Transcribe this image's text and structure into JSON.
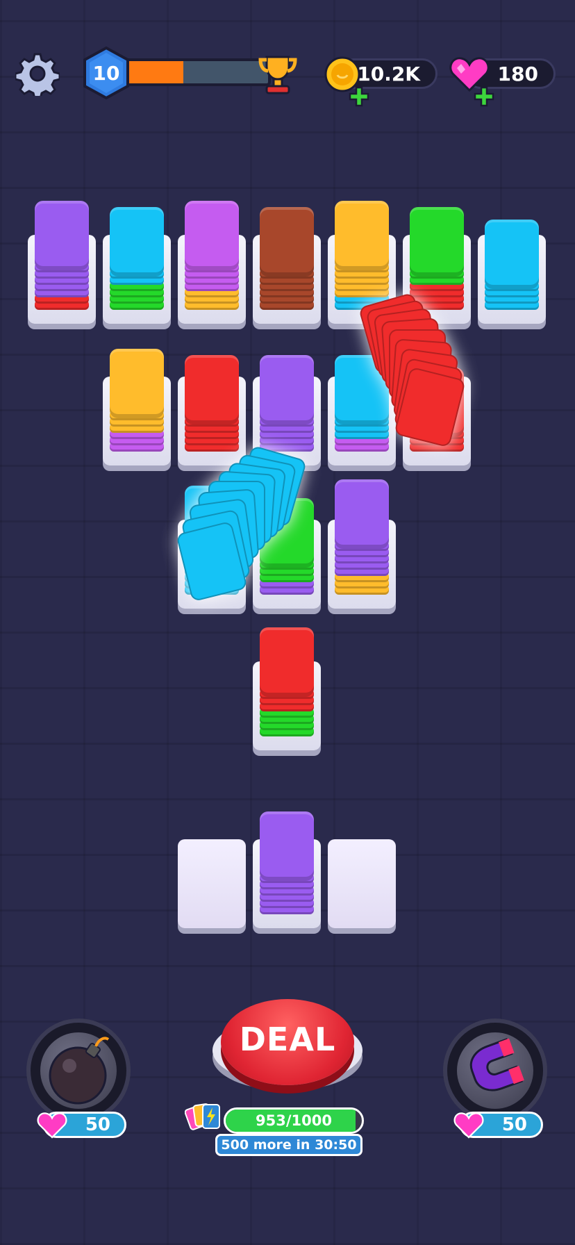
{
  "hud": {
    "level": "10",
    "level_progress": 0.4,
    "coins": "10.2K",
    "gems": "180"
  },
  "colors": {
    "purple": "#9a5cf0",
    "cyan": "#15c3f6",
    "magenta": "#c55cf0",
    "brown": "#a8472b",
    "yellow": "#ffbc2c",
    "green": "#24d92a",
    "red": "#f02c2c",
    "bg": "#2a2a4c"
  },
  "stacks": [
    {
      "layers": [
        "red",
        "red",
        "purple",
        "purple",
        "purple",
        "purple",
        "purple"
      ],
      "top": "purple"
    },
    {
      "layers": [
        "green",
        "green",
        "green",
        "green",
        "cyan",
        "cyan"
      ],
      "top": "cyan"
    },
    {
      "layers": [
        "yellow",
        "yellow",
        "yellow",
        "magenta",
        "magenta",
        "magenta",
        "magenta"
      ],
      "top": "magenta"
    },
    {
      "layers": [
        "brown",
        "brown",
        "brown",
        "brown",
        "brown",
        "brown"
      ],
      "top": "brown"
    },
    {
      "layers": [
        "cyan",
        "cyan",
        "yellow",
        "yellow",
        "yellow",
        "yellow",
        "yellow"
      ],
      "top": "yellow"
    },
    {
      "layers": [
        "red",
        "red",
        "red",
        "red",
        "green",
        "green"
      ],
      "top": "green"
    },
    {
      "layers": [
        "cyan",
        "cyan",
        "cyan",
        "cyan"
      ],
      "top": "cyan"
    },
    {
      "layers": [
        "magenta",
        "magenta",
        "magenta",
        "yellow",
        "yellow",
        "yellow"
      ],
      "top": "yellow"
    },
    {
      "layers": [
        "red",
        "red",
        "red",
        "red",
        "red"
      ],
      "top": "red"
    },
    {
      "layers": [
        "purple",
        "purple",
        "purple",
        "purple",
        "purple"
      ],
      "top": "purple"
    },
    {
      "layers": [
        "magenta",
        "magenta",
        "cyan",
        "cyan",
        "cyan"
      ],
      "top": "cyan",
      "moving": "red"
    },
    {
      "layers": [
        "red",
        "red",
        "red"
      ],
      "top": "red"
    },
    {
      "layers": [
        "cyan",
        "cyan",
        "cyan",
        "cyan",
        "cyan",
        "cyan",
        "cyan"
      ],
      "top": "cyan",
      "moving": "cyan"
    },
    {
      "layers": [
        "purple",
        "purple",
        "green",
        "green",
        "green"
      ],
      "top": "green"
    },
    {
      "layers": [
        "yellow",
        "yellow",
        "yellow",
        "purple",
        "purple",
        "purple",
        "purple",
        "purple"
      ],
      "top": "purple"
    },
    {
      "layers": [
        "green",
        "green",
        "green",
        "green",
        "red",
        "red",
        "red"
      ],
      "top": "red"
    },
    {
      "layers": [],
      "top": null,
      "empty": true
    },
    {
      "layers": [
        "purple",
        "purple",
        "purple",
        "purple",
        "purple",
        "purple"
      ],
      "top": "purple"
    },
    {
      "layers": [],
      "top": null,
      "empty": true
    }
  ],
  "boosters": {
    "bomb": {
      "icon": "bomb-icon",
      "cost": "50"
    },
    "magnet": {
      "icon": "magnet-icon",
      "cost": "50"
    }
  },
  "deal": {
    "label": "DEAL",
    "count": "953/1000",
    "progress": 0.953,
    "timer": "500 more in 30:50"
  }
}
